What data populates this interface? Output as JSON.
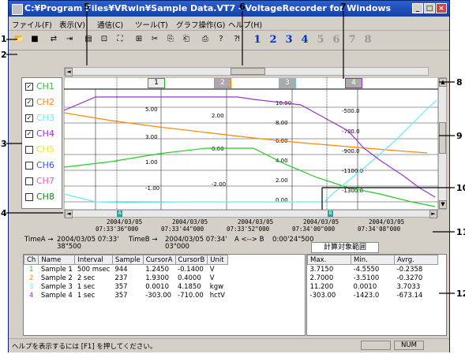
{
  "window": {
    "title": "C:¥Program Files¥VRwin¥Sample Data.VT7 - VoltageRecorder for Windows"
  },
  "menu": [
    "ファイル(F)",
    "表示(V)",
    "通信(C)",
    "ツール(T)",
    "グラフ操作(G)",
    "ヘルプ(H)"
  ],
  "toolbar": {
    "channel_numbers": [
      "1",
      "2",
      "3",
      "4",
      "5",
      "6",
      "7",
      "8"
    ]
  },
  "annotations": [
    "1",
    "2",
    "3",
    "4",
    "5",
    "6",
    "7",
    "8",
    "9",
    "10",
    "11",
    "12"
  ],
  "channels": [
    {
      "label": "CH1",
      "checked": true,
      "color": "#22cc22"
    },
    {
      "label": "CH2",
      "checked": true,
      "color": "#ff8800"
    },
    {
      "label": "CH3",
      "checked": true,
      "color": "#66eeee"
    },
    {
      "label": "CH4",
      "checked": true,
      "color": "#9933cc"
    },
    {
      "label": "CH5",
      "checked": false,
      "color": "#eeee00"
    },
    {
      "label": "CH6",
      "checked": false,
      "color": "#3355ff"
    },
    {
      "label": "CH7",
      "checked": false,
      "color": "#ee55cc"
    },
    {
      "label": "CH8",
      "checked": false,
      "color": "#118811"
    }
  ],
  "axis_selectors": [
    "1",
    "2",
    "3",
    "4"
  ],
  "axes": {
    "ch1": [
      "5.00",
      "3.00",
      "1.00",
      "-1.00"
    ],
    "ch2": [
      "2.00",
      "0.00",
      "-2.00"
    ],
    "ch3": [
      "10.00",
      "8.00",
      "6.00",
      "4.00",
      "2.00",
      "0.00"
    ],
    "ch4": [
      "-500.0",
      "-700.0",
      "-900.0",
      "-1100.0",
      "-1300.0"
    ]
  },
  "cursor_labels": [
    "A",
    "B"
  ],
  "time_ticks": [
    {
      "date": "2004/03/05",
      "time": "07:33'36\"000"
    },
    {
      "date": "2004/03/05",
      "time": "07:33'44\"000"
    },
    {
      "date": "2004/03/05",
      "time": "07:33'52\"000"
    },
    {
      "date": "2004/03/05",
      "time": "07:34'00\"000"
    },
    {
      "date": "2004/03/05",
      "time": "07:34'08\"000"
    }
  ],
  "cursor_info": {
    "timeA_label": "TimeA →",
    "timeA_value": "2004/03/05 07:33'",
    "timeA_value2": "38\"500",
    "timeB_label": "TimeB →",
    "timeB_value": "2004/03/05 07:34'",
    "timeB_value2": "03\"000",
    "diff_label": "A <--> B",
    "diff_value": "0:00'24\"500",
    "calc_button": "計算対象範囲"
  },
  "table": {
    "headers": [
      "Ch",
      "Name",
      "Interval",
      "Sample",
      "CursorA",
      "CursorB",
      "Unit"
    ],
    "rows": [
      {
        "ch": "1",
        "name": "Sample 1",
        "interval": "500 msec",
        "sample": "944",
        "a": "1.2450",
        "b": "-0.1400",
        "unit": "V"
      },
      {
        "ch": "2",
        "name": "Sample 2",
        "interval": "2 sec",
        "sample": "237",
        "a": "1.9300",
        "b": "0.4000",
        "unit": "V"
      },
      {
        "ch": "3",
        "name": "Sample 3",
        "interval": "1 sec",
        "sample": "357",
        "a": "0.0010",
        "b": "4.1850",
        "unit": "kgw"
      },
      {
        "ch": "4",
        "name": "Sample 4",
        "interval": "1 sec",
        "sample": "357",
        "a": "-303.00",
        "b": "-710.00",
        "unit": "hctV"
      }
    ]
  },
  "stats": {
    "headers": [
      "Max.",
      "Min.",
      "Avrg."
    ],
    "rows": [
      [
        "3.7150",
        "-4.5550",
        "-0.2358"
      ],
      [
        "2.7000",
        "-3.5100",
        "-0.3270"
      ],
      [
        "11.200",
        "0.0010",
        "3.7033"
      ],
      [
        "-303.00",
        "-1423.0",
        "-673.14"
      ]
    ]
  },
  "status": {
    "help": "ヘルプを表示するには [F1] を押してください。",
    "num": "NUM"
  }
}
